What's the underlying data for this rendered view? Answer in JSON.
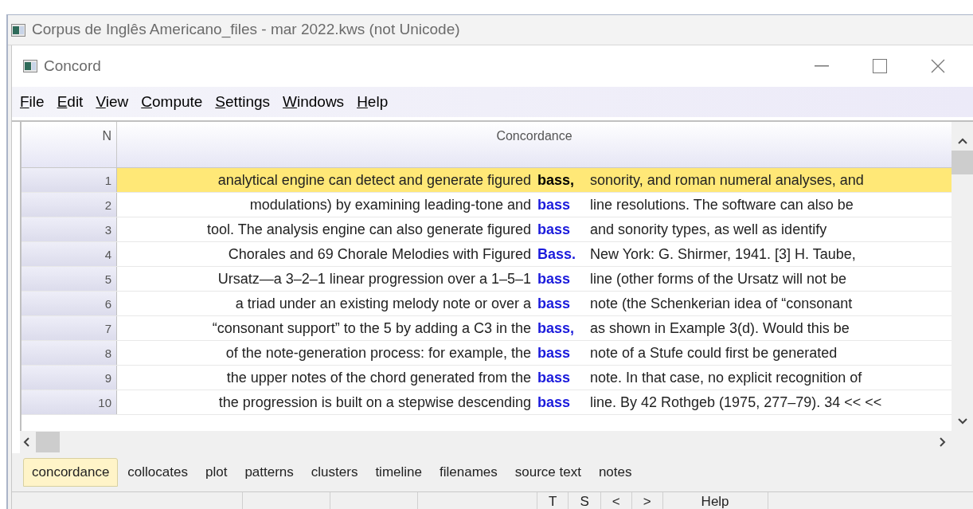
{
  "outer_window": {
    "title": "Corpus de Inglês Americano_files - mar 2022.kws (not Unicode)"
  },
  "window": {
    "title": "Concord"
  },
  "menu": [
    {
      "accel": "F",
      "rest": "ile"
    },
    {
      "accel": "E",
      "rest": "dit"
    },
    {
      "accel": "V",
      "rest": "iew"
    },
    {
      "accel": "C",
      "rest": "ompute"
    },
    {
      "accel": "S",
      "rest": "ettings"
    },
    {
      "accel": "W",
      "rest": "indows"
    },
    {
      "accel": "H",
      "rest": "elp"
    }
  ],
  "table": {
    "columns": [
      "N",
      "Concordance"
    ],
    "rows": [
      {
        "n": "1",
        "left": "analytical engine can detect and generate figured",
        "keyword": "bass,",
        "right": "sonority, and roman numeral analyses, and",
        "selected": true
      },
      {
        "n": "2",
        "left": "modulations) by examining leading-tone and",
        "keyword": "bass",
        "right": "line resolutions. The software can also be",
        "selected": false
      },
      {
        "n": "3",
        "left": "tool. The analysis engine can also generate figured",
        "keyword": "bass",
        "right": "and sonority types, as well as identify",
        "selected": false
      },
      {
        "n": "4",
        "left": "Chorales and 69 Chorale Melodies with Figured",
        "keyword": "Bass.",
        "right": "New York: G. Shirmer, 1941. [3] H. Taube,",
        "selected": false
      },
      {
        "n": "5",
        "left": "Ursatz—a 3–2–1 linear progression over a 1–5–1",
        "keyword": "bass",
        "right": "line (other forms of the Ursatz will not be",
        "selected": false
      },
      {
        "n": "6",
        "left": "a triad under an existing melody note or over a",
        "keyword": "bass",
        "right": "note (the Schenkerian idea of “consonant",
        "selected": false
      },
      {
        "n": "7",
        "left": "“consonant support” to the 5 by adding a C3 in the",
        "keyword": "bass,",
        "right": "as shown in Example 3(d). Would this be",
        "selected": false
      },
      {
        "n": "8",
        "left": "of the note-generation process: for example, the",
        "keyword": "bass",
        "right": "note of a Stufe could first be generated",
        "selected": false
      },
      {
        "n": "9",
        "left": "the upper notes of the chord generated from the",
        "keyword": "bass",
        "right": "note. In that case, no explicit recognition of",
        "selected": false
      },
      {
        "n": "10",
        "left": "the progression is built on a stepwise descending",
        "keyword": "bass",
        "right": "line. By 42 Rothgeb (1975, 277–79). 34 << <<",
        "selected": false
      }
    ]
  },
  "tabs": [
    {
      "label": "concordance",
      "selected": true
    },
    {
      "label": "collocates",
      "selected": false
    },
    {
      "label": "plot",
      "selected": false
    },
    {
      "label": "patterns",
      "selected": false
    },
    {
      "label": "clusters",
      "selected": false
    },
    {
      "label": "timeline",
      "selected": false
    },
    {
      "label": "filenames",
      "selected": false
    },
    {
      "label": "source text",
      "selected": false
    },
    {
      "label": "notes",
      "selected": false
    }
  ],
  "status_bar": [
    "T",
    "S",
    "<",
    ">",
    "Help"
  ]
}
